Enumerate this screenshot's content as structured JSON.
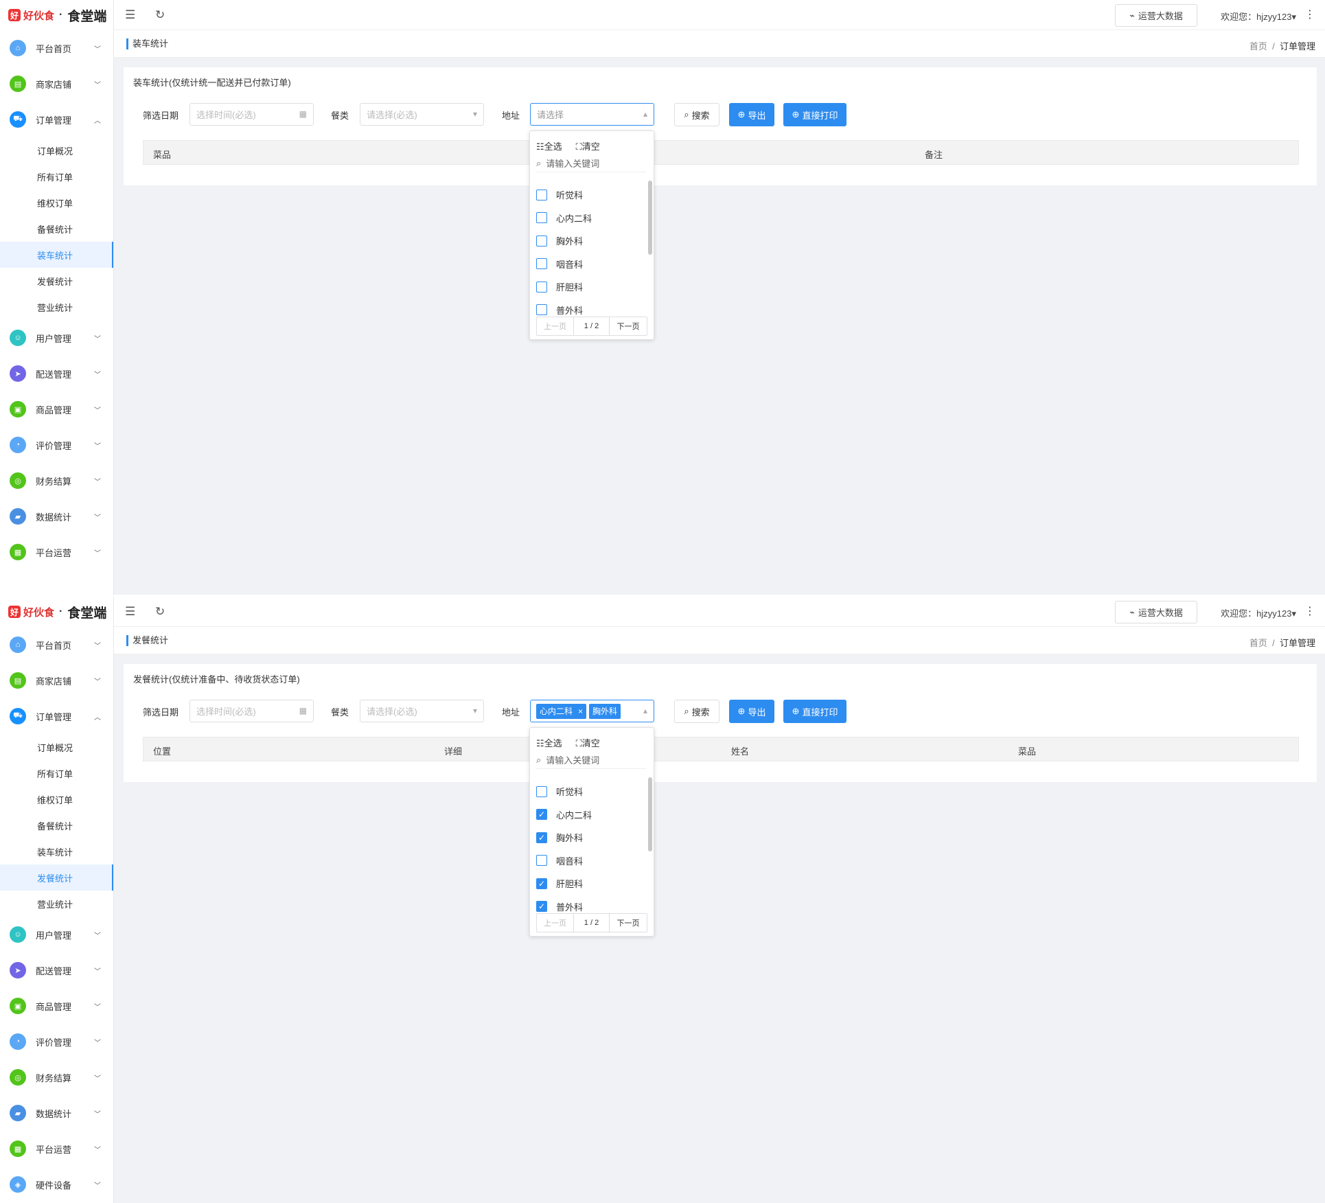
{
  "brand": {
    "logo_mark": "好",
    "logo_name": "好伙食",
    "separator": "·",
    "title": "食堂端"
  },
  "header": {
    "bigdata_label": "运营大数据",
    "welcome": "欢迎您：hjzyy123",
    "caret": "▾",
    "more": "⋮",
    "menu_toggle_icon": "☰",
    "refresh_icon": "↻"
  },
  "menu": {
    "items": [
      {
        "label": "平台首页",
        "color": "#5aa7f5",
        "icon": "⌂"
      },
      {
        "label": "商家店铺",
        "color": "#52c41a",
        "icon": "▤"
      },
      {
        "label": "订单管理",
        "color": "#1890ff",
        "icon": "⛟"
      },
      {
        "label": "用户管理",
        "color": "#2fc3c3",
        "icon": "☺"
      },
      {
        "label": "配送管理",
        "color": "#7265e6",
        "icon": "➤"
      },
      {
        "label": "商品管理",
        "color": "#52c41a",
        "icon": "▣"
      },
      {
        "label": "评价管理",
        "color": "#5aa7f5",
        "icon": "◔"
      },
      {
        "label": "财务结算",
        "color": "#52c41a",
        "icon": "◎"
      },
      {
        "label": "数据统计",
        "color": "#4a90e2",
        "icon": "▰"
      },
      {
        "label": "平台运营",
        "color": "#52c41a",
        "icon": "▦"
      },
      {
        "label": "硬件设备",
        "color": "#5aa7f5",
        "icon": "◈"
      }
    ],
    "sub_items": [
      "订单概况",
      "所有订单",
      "维权订单",
      "备餐统计",
      "装车统计",
      "发餐统计",
      "营业统计"
    ]
  },
  "breadcrumb": {
    "home": "首页",
    "sep": "/",
    "current": "订单管理"
  },
  "filters": {
    "date_label": "筛选日期",
    "date_placeholder": "选择时间(必选)",
    "meal_label": "餐类",
    "meal_placeholder": "请选择(必选)",
    "address_label": "地址",
    "address_placeholder": "请选择",
    "search_label": "搜索",
    "export_label": "导出",
    "print_label": "直接打印"
  },
  "dropdown": {
    "select_all": "全选",
    "clear": "清空",
    "search_placeholder": "请输入关键词",
    "options": [
      "听觉科",
      "心内二科",
      "胸外科",
      "咽音科",
      "肝胆科",
      "普外科"
    ],
    "prev": "上一页",
    "page": "1 / 2",
    "next": "下一页"
  },
  "panel1": {
    "page_title": "装车统计",
    "card_title": "装车统计(仅统计统一配送并已付款订单)",
    "columns": [
      "菜品",
      "备注"
    ],
    "checked": [
      false,
      false,
      false,
      false,
      false,
      false
    ]
  },
  "panel2": {
    "page_title": "发餐统计",
    "card_title": "发餐统计(仅统计准备中、待收货状态订单)",
    "columns": [
      "位置",
      "详细",
      "姓名",
      "菜品"
    ],
    "tags": [
      "心内二科",
      "胸外科"
    ],
    "checked": [
      false,
      true,
      true,
      false,
      true,
      true
    ]
  }
}
